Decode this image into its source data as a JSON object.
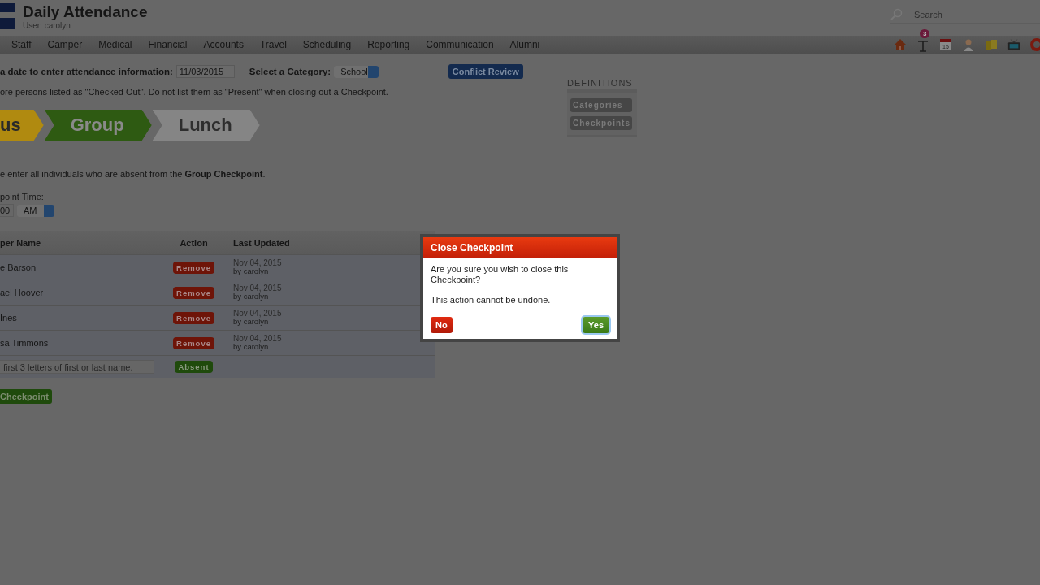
{
  "header": {
    "title": "Daily Attendance",
    "user": "User: carolyn",
    "search": {
      "placeholder": "Search"
    }
  },
  "nav": {
    "items": [
      "Staff",
      "Camper",
      "Medical",
      "Financial",
      "Accounts",
      "Travel",
      "Scheduling",
      "Reporting",
      "Communication",
      "Alumni"
    ]
  },
  "toolbar": [
    {
      "kind": "home"
    },
    {
      "kind": "sign",
      "badge": "3"
    },
    {
      "kind": "calendar",
      "label": "15"
    },
    {
      "kind": "person"
    },
    {
      "kind": "folders"
    },
    {
      "kind": "tv"
    },
    {
      "kind": "lifebuoy"
    }
  ],
  "date_row": {
    "label": "a date to enter attendance information:",
    "date": "11/03/2015",
    "category_label": "Select a Category:",
    "category": "School",
    "conflict_button": "Conflict Review"
  },
  "note": "ore persons listed as \"Checked Out\". Do not list them as \"Present\" when closing out a Checkpoint.",
  "definitions": {
    "title": "DEFINITIONS",
    "buttons": [
      "Categories",
      "Checkpoints"
    ]
  },
  "steps": [
    {
      "label": "us",
      "color": "#b08a10"
    },
    {
      "label": "Group",
      "color": "#2e5a12"
    },
    {
      "label": "Lunch",
      "color": "#858585"
    }
  ],
  "instruction": "e enter all individuals who are absent from the **Group Checkpoint**.",
  "time": {
    "label": "point Time:",
    "value": "00",
    "ampm": "AM"
  },
  "table": {
    "columns": [
      "per Name",
      "Action",
      "Last Updated"
    ],
    "rows": [
      {
        "name": "e Barson",
        "action": "Remove",
        "date": "Nov 04, 2015",
        "by": "by carolyn"
      },
      {
        "name": "ael Hoover",
        "action": "Remove",
        "date": "Nov 04, 2015",
        "by": "by carolyn"
      },
      {
        "name": "Ines",
        "action": "Remove",
        "date": "Nov 04, 2015",
        "by": "by carolyn"
      },
      {
        "name": "sa Timmons",
        "action": "Remove",
        "date": "Nov 04, 2015",
        "by": "by carolyn"
      }
    ],
    "entry": {
      "placeholder": "first 3 letters of first or last name.",
      "button": "Absent"
    }
  },
  "close_button": "Checkpoint",
  "dialog": {
    "title": "Close Checkpoint",
    "message": "Are you sure you wish to close this Checkpoint?",
    "warning": "This action cannot be undone.",
    "no": "No",
    "yes": "Yes"
  }
}
